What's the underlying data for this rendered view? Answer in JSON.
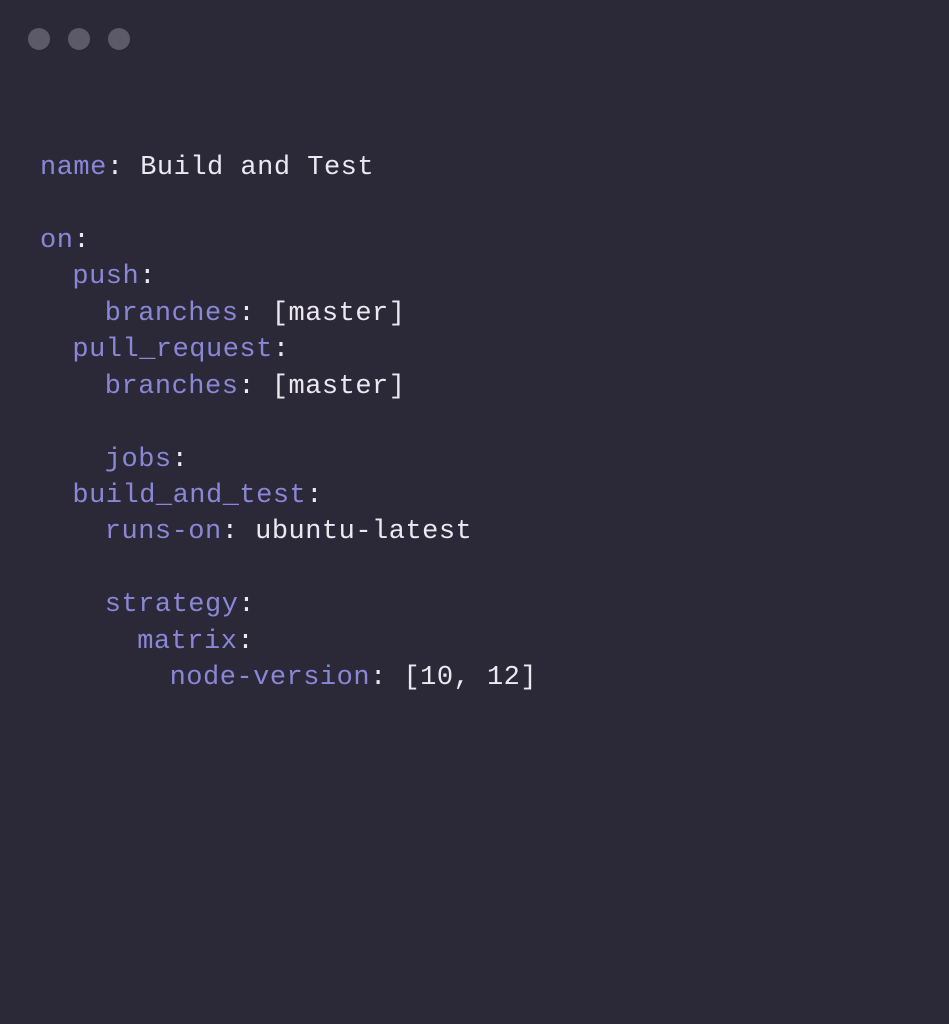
{
  "lines": {
    "l1_key": "name",
    "l1_colon": ": ",
    "l1_val": "Build and Test",
    "l3_key": "on",
    "l3_colon": ":",
    "l4_key": "push",
    "l4_colon": ":",
    "l5_key": "branches",
    "l5_colon": ": ",
    "l5_val": "[master]",
    "l6_key": "pull_request",
    "l6_colon": ":",
    "l7_key": "branches",
    "l7_colon": ": ",
    "l7_val": "[master]",
    "l9_key": "jobs",
    "l9_colon": ":",
    "l10_key": "build_and_test",
    "l10_colon": ":",
    "l11_key": "runs-on",
    "l11_colon": ": ",
    "l11_val": "ubuntu-latest",
    "l13_key": "strategy",
    "l13_colon": ":",
    "l14_key": "matrix",
    "l14_colon": ":",
    "l15_key": "node-version",
    "l15_colon": ": ",
    "l15_val": "[10, 12]"
  }
}
